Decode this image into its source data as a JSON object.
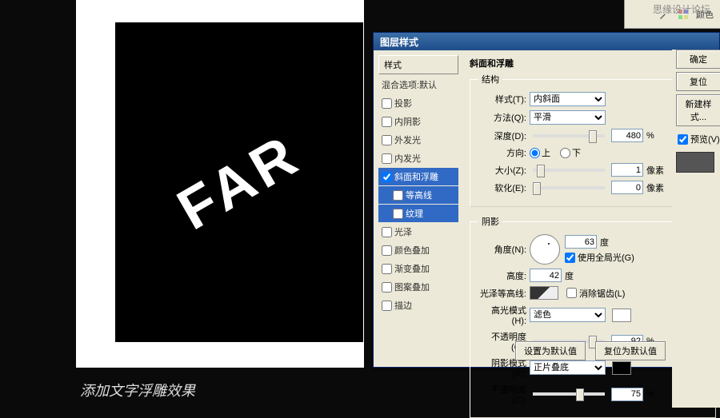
{
  "watermark": "思缘设计论坛",
  "canvas_text": "FAR",
  "caption": "添加文字浮雕效果",
  "toolbar": {
    "swatch": "颜色"
  },
  "dialog": {
    "title": "图层样式",
    "left_header": "样式",
    "blend_opts": "混合选项:默认",
    "styles": [
      {
        "k": "dropshadow",
        "label": "投影",
        "sel": false,
        "chk": false
      },
      {
        "k": "innershadow",
        "label": "内阴影",
        "sel": false,
        "chk": false
      },
      {
        "k": "outerglow",
        "label": "外发光",
        "sel": false,
        "chk": false
      },
      {
        "k": "innerglow",
        "label": "内发光",
        "sel": false,
        "chk": false
      },
      {
        "k": "bevel",
        "label": "斜面和浮雕",
        "sel": true,
        "chk": true
      },
      {
        "k": "contour",
        "label": "等高线",
        "sel": true,
        "chk": false,
        "sub": true
      },
      {
        "k": "texture",
        "label": "纹理",
        "sel": true,
        "chk": false,
        "sub": true
      },
      {
        "k": "satin",
        "label": "光泽",
        "sel": false,
        "chk": false
      },
      {
        "k": "coloroverlay",
        "label": "颜色叠加",
        "sel": false,
        "chk": false
      },
      {
        "k": "gradoverlay",
        "label": "渐变叠加",
        "sel": false,
        "chk": false
      },
      {
        "k": "patoverlay",
        "label": "图案叠加",
        "sel": false,
        "chk": false
      },
      {
        "k": "stroke",
        "label": "描边",
        "sel": false,
        "chk": false
      }
    ],
    "structure": {
      "group": "结构",
      "section": "斜面和浮雕",
      "style_l": "样式(T):",
      "style_v": "内斜面",
      "tech_l": "方法(Q):",
      "tech_v": "平滑",
      "depth_l": "深度(D):",
      "depth_v": "480",
      "depth_u": "%",
      "dir_l": "方向:",
      "up": "上",
      "down": "下",
      "size_l": "大小(Z):",
      "size_v": "1",
      "size_u": "像素",
      "soften_l": "软化(E):",
      "soften_v": "0",
      "soften_u": "像素"
    },
    "shading": {
      "group": "阴影",
      "angle_l": "角度(N):",
      "angle_v": "63",
      "angle_u": "度",
      "global": "使用全局光(G)",
      "alt_l": "高度:",
      "alt_v": "42",
      "alt_u": "度",
      "gloss_l": "光泽等高线:",
      "aa": "消除锯齿(L)",
      "hi_l": "高光模式(H):",
      "hi_v": "滤色",
      "hiop_l": "不透明度(O):",
      "hiop_v": "92",
      "hiop_u": "%",
      "sh_l": "阴影模式(A):",
      "sh_v": "正片叠底",
      "shop_l": "不透明度(C):",
      "shop_v": "75",
      "shop_u": "%"
    },
    "footer": {
      "default": "设置为默认值",
      "reset": "复位为默认值"
    },
    "right": {
      "ok": "确定",
      "cancel": "复位",
      "newstyle": "新建样式...",
      "preview": "预览(V)"
    }
  }
}
